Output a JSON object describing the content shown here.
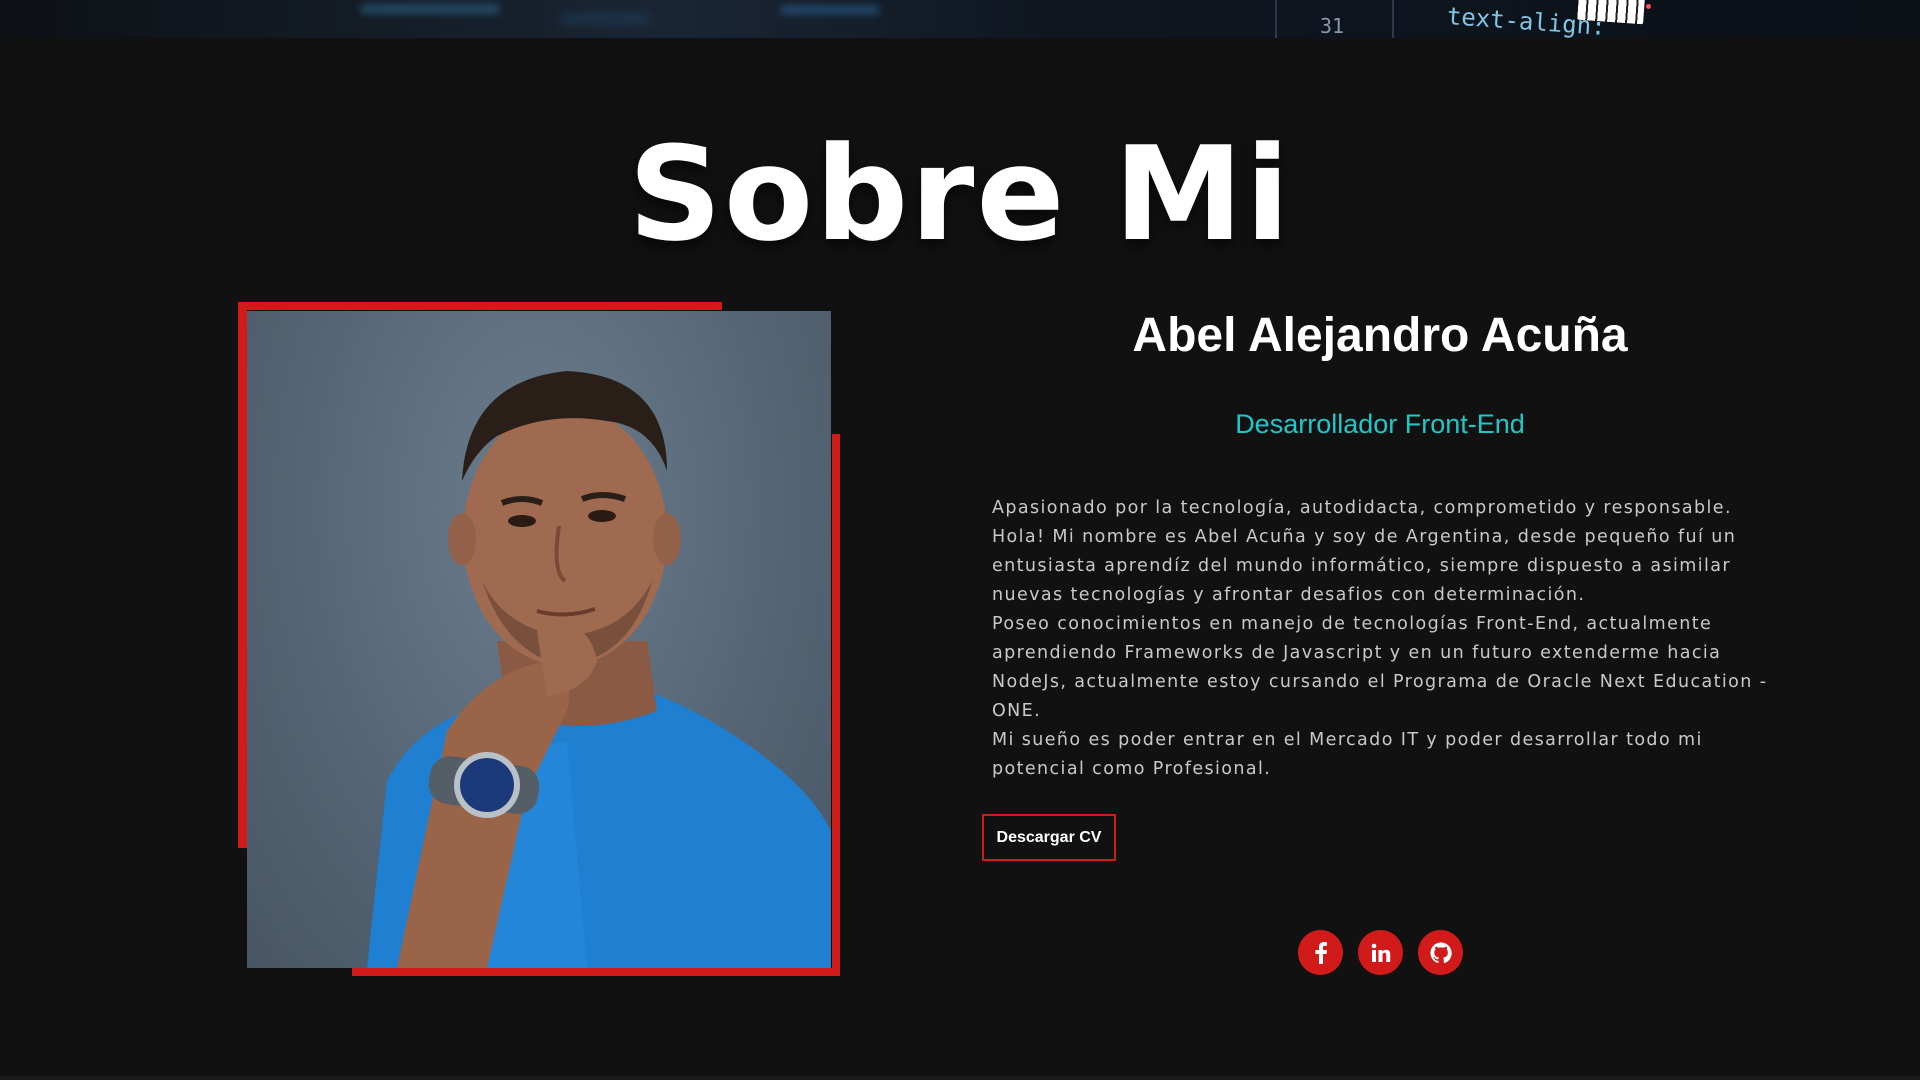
{
  "header": {
    "code_line_number": "31",
    "code_snippet": "text-align:"
  },
  "section": {
    "title": "Sobre Mi"
  },
  "profile": {
    "photo_alt": "Foto de perfil",
    "name": "Abel Alejandro Acuña",
    "role": "Desarrollador Front-End",
    "bio_lines": [
      "Apasionado por la tecnología, autodidacta, comprometido y responsable.",
      "Hola! Mi nombre es Abel Acuña y soy de Argentina, desde pequeño fuí un entusiasta aprendíz del mundo informático, siempre dispuesto a asimilar nuevas tecnologías y afrontar desafios con determinación.",
      "Poseo conocimientos en manejo de tecnologías Front-End, actualmente aprendiendo Frameworks de Javascript y en un futuro extenderme hacia NodeJs, actualmente estoy cursando el Programa de Oracle Next Education - ONE.",
      "Mi sueño es poder entrar en el Mercado IT y poder desarrollar todo mi potencial como Profesional."
    ],
    "cv_button_label": "Descargar CV"
  },
  "socials": [
    {
      "icon": "facebook-icon"
    },
    {
      "icon": "linkedin-icon"
    },
    {
      "icon": "github-icon"
    }
  ],
  "colors": {
    "background": "#111111",
    "accent_red": "#d11b1b",
    "accent_cyan": "#1fc7c9",
    "text": "#ffffff",
    "bio_text": "#c9c9c9"
  }
}
